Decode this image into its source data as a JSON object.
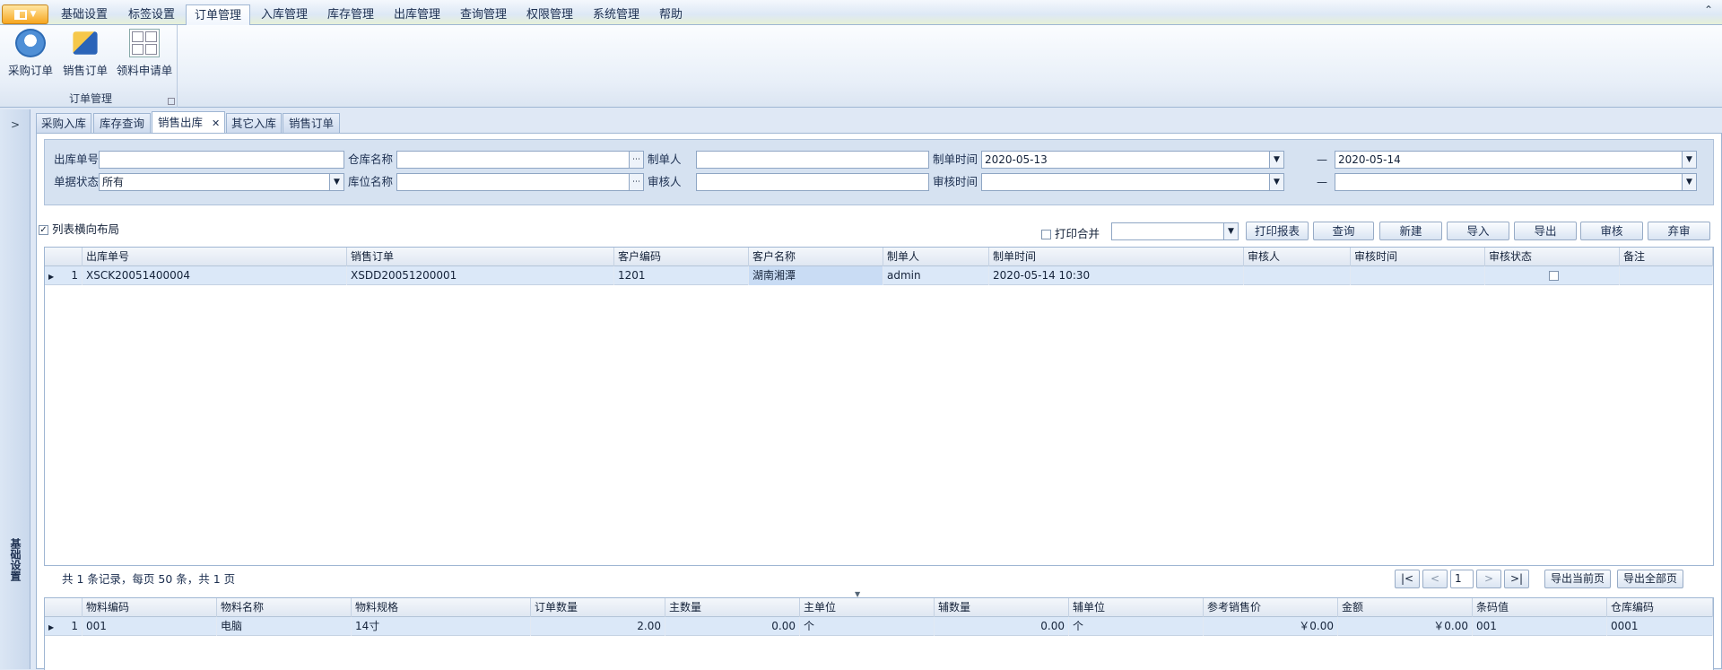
{
  "ribbon": {
    "tabs": [
      "基础设置",
      "标签设置",
      "订单管理",
      "入库管理",
      "库存管理",
      "出库管理",
      "查询管理",
      "权限管理",
      "系统管理",
      "帮助"
    ],
    "active_tab": "订单管理",
    "group": {
      "label": "订单管理",
      "buttons": [
        {
          "label": "采购订单",
          "icon": "purchase-order-icon"
        },
        {
          "label": "销售订单",
          "icon": "sales-order-icon"
        },
        {
          "label": "领料申请单",
          "icon": "material-requisition-icon"
        }
      ]
    }
  },
  "sidebar": {
    "label": "基础设置"
  },
  "doc_tabs": [
    "采购入库",
    "库存查询",
    "销售出库",
    "其它入库",
    "销售订单"
  ],
  "active_doc_tab": "销售出库",
  "filter": {
    "outbound_no_label": "出库单号",
    "outbound_no_value": "",
    "warehouse_label": "仓库名称",
    "warehouse_value": "",
    "creator_label": "制单人",
    "creator_value": "",
    "create_time_label": "制单时间",
    "date_from": "2020-05-13",
    "date_sep": "—",
    "date_to": "2020-05-14",
    "doc_status_label": "单据状态",
    "doc_status_value": "所有",
    "location_label": "库位名称",
    "location_value": "",
    "reviewer_label": "审核人",
    "reviewer_value": "",
    "review_time_label": "审核时间",
    "review_from": "",
    "review_sep": "—",
    "review_to": ""
  },
  "options": {
    "horizontal_layout_label": "列表横向布局",
    "horizontal_layout_checked": true,
    "print_merge_label": "打印合并",
    "print_merge_checked": false,
    "print_template_value": ""
  },
  "toolbar": [
    "打印报表",
    "查询",
    "新建",
    "导入",
    "导出",
    "审核",
    "弃审"
  ],
  "master_grid": {
    "columns": [
      "出库单号",
      "销售订单",
      "客户编码",
      "客户名称",
      "制单人",
      "制单时间",
      "审核人",
      "审核时间",
      "审核状态",
      "备注"
    ],
    "rows": [
      {
        "idx": "1",
        "cells": [
          "XSCK20051400004",
          "XSDD20051200001",
          "1201",
          "湖南湘潭",
          "admin",
          "2020-05-14 10:30",
          "",
          "",
          "",
          ""
        ]
      }
    ]
  },
  "pager": {
    "summary": "共 1 条记录，每页 50 条，共 1 页",
    "first": "|<",
    "prev": "<",
    "page": "1",
    "next": ">",
    "last": ">|",
    "export_current": "导出当前页",
    "export_all": "导出全部页"
  },
  "detail_grid": {
    "columns": [
      "物料编码",
      "物料名称",
      "物料规格",
      "订单数量",
      "主数量",
      "主单位",
      "辅数量",
      "辅单位",
      "参考销售价",
      "金额",
      "条码值",
      "仓库编码"
    ],
    "rows": [
      {
        "idx": "1",
        "cells": [
          "001",
          "电脑",
          "14寸",
          "2.00",
          "0.00",
          "个",
          "0.00",
          "个",
          "￥0.00",
          "￥0.00",
          "001",
          "0001"
        ]
      }
    ]
  }
}
